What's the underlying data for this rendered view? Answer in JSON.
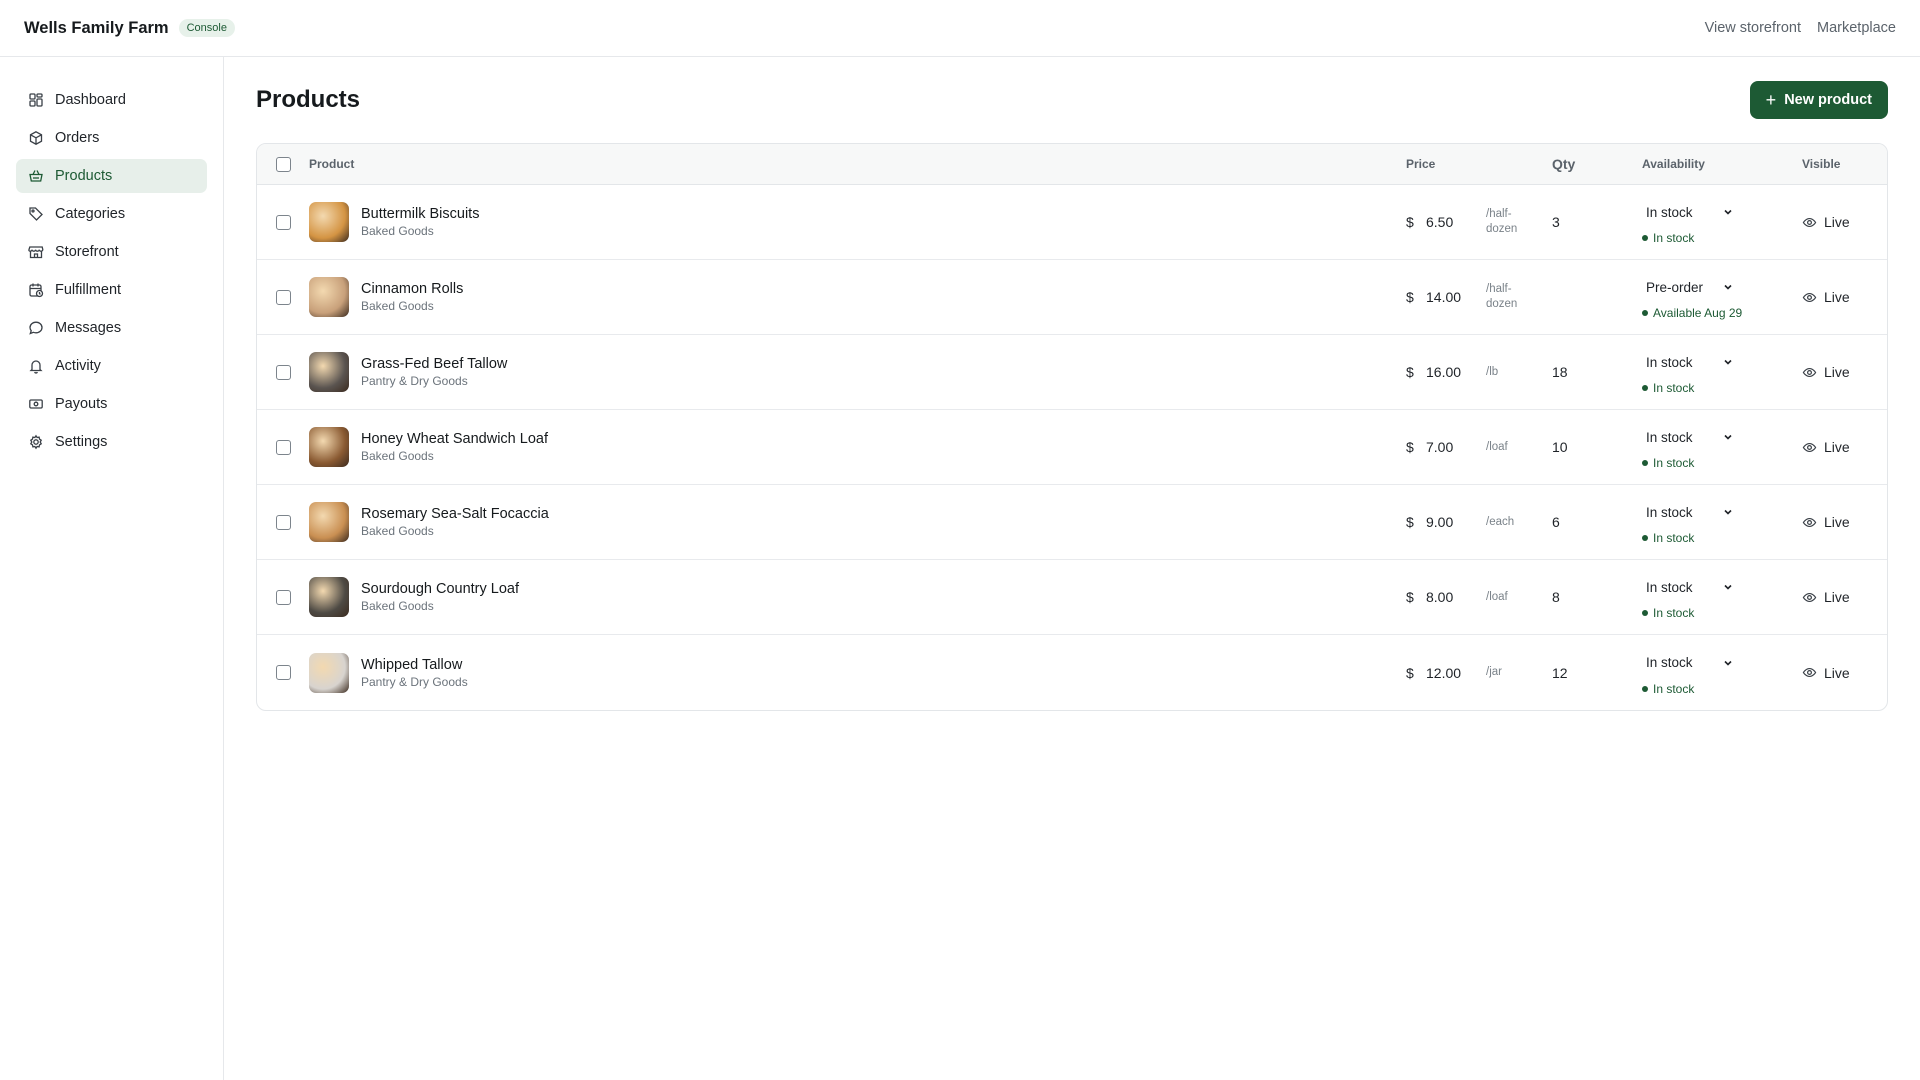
{
  "header": {
    "brand": "Wells Family Farm",
    "badge": "Console",
    "links": [
      "View storefront",
      "Marketplace"
    ]
  },
  "sidebar": {
    "items": [
      {
        "label": "Dashboard",
        "icon": "dashboard-icon",
        "active": false
      },
      {
        "label": "Orders",
        "icon": "box-icon",
        "active": false
      },
      {
        "label": "Products",
        "icon": "basket-icon",
        "active": true
      },
      {
        "label": "Categories",
        "icon": "tag-icon",
        "active": false
      },
      {
        "label": "Storefront",
        "icon": "store-icon",
        "active": false
      },
      {
        "label": "Fulfillment",
        "icon": "calendar-clock-icon",
        "active": false
      },
      {
        "label": "Messages",
        "icon": "chat-icon",
        "active": false
      },
      {
        "label": "Activity",
        "icon": "bell-icon",
        "active": false
      },
      {
        "label": "Payouts",
        "icon": "banknote-icon",
        "active": false
      },
      {
        "label": "Settings",
        "icon": "gear-icon",
        "active": false
      }
    ]
  },
  "main": {
    "title": "Products",
    "new_button": "New product",
    "columns": {
      "product": "Product",
      "price": "Price",
      "qty": "Qty",
      "availability": "Availability",
      "visible": "Visible"
    },
    "currency": "$",
    "rows": [
      {
        "name": "Buttermilk Biscuits",
        "category": "Baked Goods",
        "price": "6.50",
        "unit": "/half-dozen",
        "qty": "3",
        "availability": "In stock",
        "status": "In stock",
        "visible": "Live",
        "thumb_color": "#d49443"
      },
      {
        "name": "Cinnamon Rolls",
        "category": "Baked Goods",
        "price": "14.00",
        "unit": "/half-dozen",
        "qty": "",
        "availability": "Pre-order",
        "status": "Available Aug 29",
        "visible": "Live",
        "thumb_color": "#c8a07a"
      },
      {
        "name": "Grass-Fed Beef Tallow",
        "category": "Pantry & Dry Goods",
        "price": "16.00",
        "unit": "/lb",
        "qty": "18",
        "availability": "In stock",
        "status": "In stock",
        "visible": "Live",
        "thumb_color": "#5a5450"
      },
      {
        "name": "Honey Wheat Sandwich Loaf",
        "category": "Baked Goods",
        "price": "7.00",
        "unit": "/loaf",
        "qty": "10",
        "availability": "In stock",
        "status": "In stock",
        "visible": "Live",
        "thumb_color": "#8a5a32"
      },
      {
        "name": "Rosemary Sea-Salt Focaccia",
        "category": "Baked Goods",
        "price": "9.00",
        "unit": "/each",
        "qty": "6",
        "availability": "In stock",
        "status": "In stock",
        "visible": "Live",
        "thumb_color": "#c98f52"
      },
      {
        "name": "Sourdough Country Loaf",
        "category": "Baked Goods",
        "price": "8.00",
        "unit": "/loaf",
        "qty": "8",
        "availability": "In stock",
        "status": "In stock",
        "visible": "Live",
        "thumb_color": "#4e4a44"
      },
      {
        "name": "Whipped Tallow",
        "category": "Pantry & Dry Goods",
        "price": "12.00",
        "unit": "/jar",
        "qty": "12",
        "availability": "In stock",
        "status": "In stock",
        "visible": "Live",
        "thumb_color": "#d8d4cf"
      }
    ]
  },
  "colors": {
    "accent": "#1d5a34",
    "active_nav_bg": "#e7efea"
  }
}
